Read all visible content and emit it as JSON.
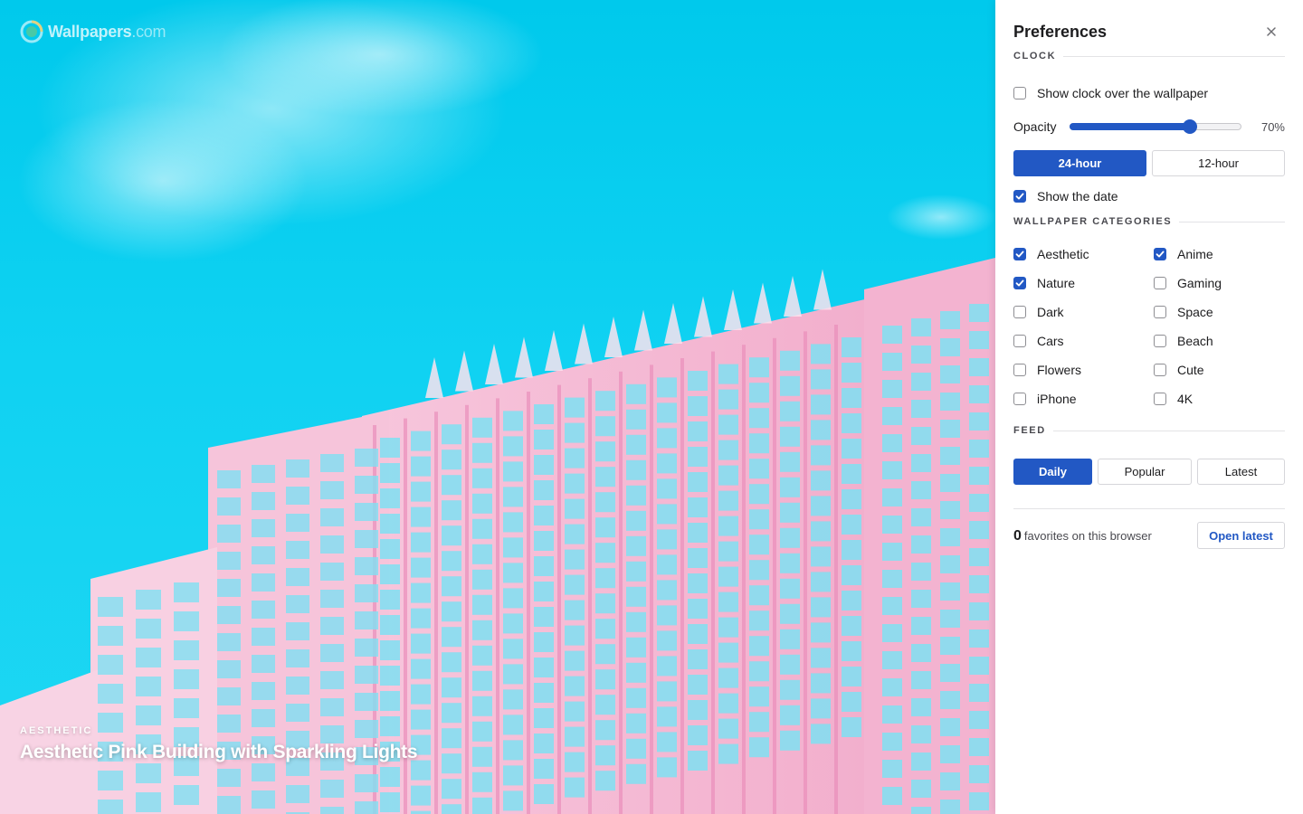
{
  "brand": {
    "name": "Wallpapers",
    "tld": ".com"
  },
  "wallpaper": {
    "category": "AESTHETIC",
    "title": "Aesthetic Pink Building with Sparkling Lights",
    "colors": {
      "sky": "#00c9ec",
      "building": "#f4b6d2",
      "glass": "#7fe0f2"
    }
  },
  "panel": {
    "title": "Preferences",
    "close_icon": "close-icon",
    "clock": {
      "section_label": "CLOCK",
      "show_clock_label": "Show clock over the wallpaper",
      "show_clock_checked": false,
      "opacity_label": "Opacity",
      "opacity_value": 70,
      "opacity_text": "70%",
      "format_options": [
        "24-hour",
        "12-hour"
      ],
      "format_selected": "24-hour",
      "show_date_label": "Show the date",
      "show_date_checked": true
    },
    "categories": {
      "section_label": "WALLPAPER CATEGORIES",
      "items": [
        {
          "label": "Aesthetic",
          "checked": true
        },
        {
          "label": "Anime",
          "checked": true
        },
        {
          "label": "Nature",
          "checked": true
        },
        {
          "label": "Gaming",
          "checked": false
        },
        {
          "label": "Dark",
          "checked": false
        },
        {
          "label": "Space",
          "checked": false
        },
        {
          "label": "Cars",
          "checked": false
        },
        {
          "label": "Beach",
          "checked": false
        },
        {
          "label": "Flowers",
          "checked": false
        },
        {
          "label": "Cute",
          "checked": false
        },
        {
          "label": "iPhone",
          "checked": false
        },
        {
          "label": "4K",
          "checked": false
        }
      ]
    },
    "feed": {
      "section_label": "FEED",
      "options": [
        "Daily",
        "Popular",
        "Latest"
      ],
      "selected": "Daily"
    },
    "favorites": {
      "count": "0",
      "text": "favorites on this browser",
      "button_label": "Open latest"
    },
    "accent_color": "#2258c4"
  }
}
